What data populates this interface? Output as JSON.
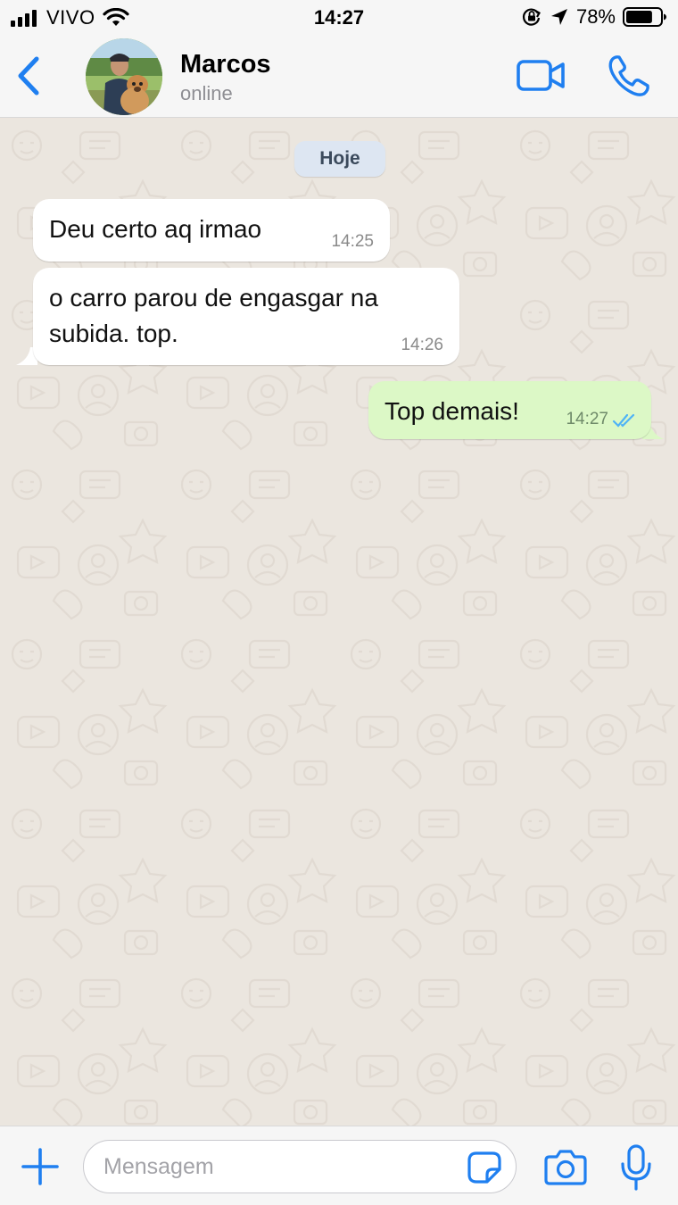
{
  "status_bar": {
    "carrier": "VIVO",
    "time": "14:27",
    "battery_percent": "78%",
    "battery_level": 0.78,
    "icons": [
      "signal-bars-icon",
      "wifi-icon",
      "orientation-lock-icon",
      "location-arrow-icon",
      "battery-icon"
    ]
  },
  "header": {
    "contact_name": "Marcos",
    "contact_status": "online",
    "icons": [
      "back-chevron-icon",
      "video-camera-icon",
      "phone-icon"
    ]
  },
  "chat": {
    "date_label": "Hoje",
    "messages": [
      {
        "direction": "incoming",
        "lines": [
          "Deu certo aq irmao"
        ],
        "time": "14:25"
      },
      {
        "direction": "incoming",
        "lines": [
          "o carro parou de engasgar na",
          "subida. top."
        ],
        "time": "14:26"
      },
      {
        "direction": "outgoing",
        "lines": [
          "Top demais!"
        ],
        "time": "14:27",
        "status": "read"
      }
    ]
  },
  "input_bar": {
    "placeholder": "Mensagem",
    "value": "",
    "icons": [
      "plus-icon",
      "sticker-icon",
      "camera-icon",
      "microphone-icon"
    ]
  },
  "colors": {
    "accent": "#1f7ff0",
    "incoming_bubble": "#ffffff",
    "outgoing_bubble": "#dcf8c6",
    "read_ticks": "#4fb3f6",
    "chat_background": "#ebe6df"
  }
}
